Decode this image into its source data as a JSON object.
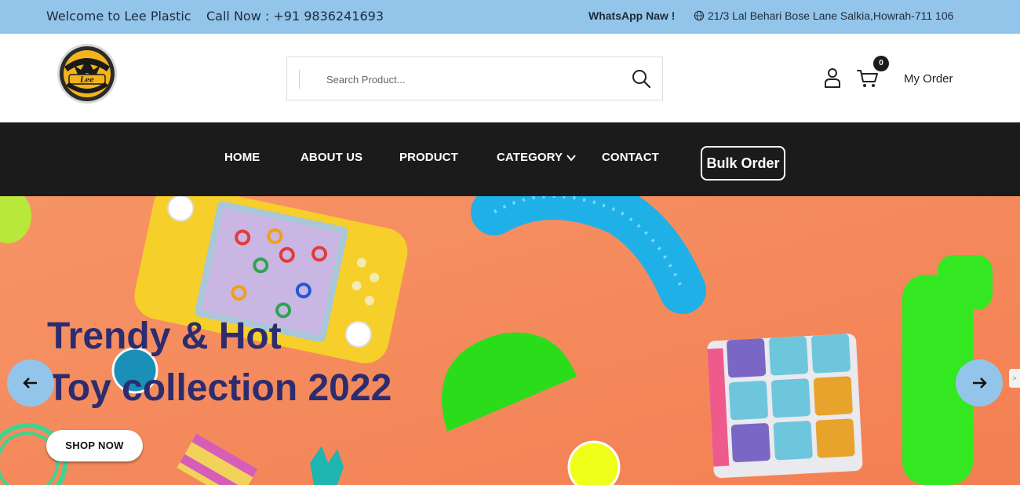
{
  "topbar": {
    "welcome": "Welcome to Lee Plastic",
    "call": "Call Now : +91 9836241693",
    "whatsapp": "WhatsApp Naw !",
    "address": "21/3 Lal Behari Bose Lane Salkia,Howrah-711 106",
    "address_icon": "globe-icon"
  },
  "header": {
    "logo_text": "Lee",
    "search_placeholder": "Search Product...",
    "cart_count": "0",
    "my_order": "My Order"
  },
  "nav": {
    "items": [
      "HOME",
      "ABOUT US",
      "PRODUCT",
      "CATEGORY",
      "CONTACT"
    ],
    "bulk_order": "Bulk Order"
  },
  "hero": {
    "title_line1": "Trendy & Hot",
    "title_line2": "Toy collection 2022",
    "shop_now": "SHOP NOW",
    "side_tab": ">"
  },
  "colors": {
    "topbar_bg": "#93c5ea",
    "nav_bg": "#1b1b1b",
    "hero_bg": "#f58a5c",
    "hero_title": "#2c2c6f"
  }
}
